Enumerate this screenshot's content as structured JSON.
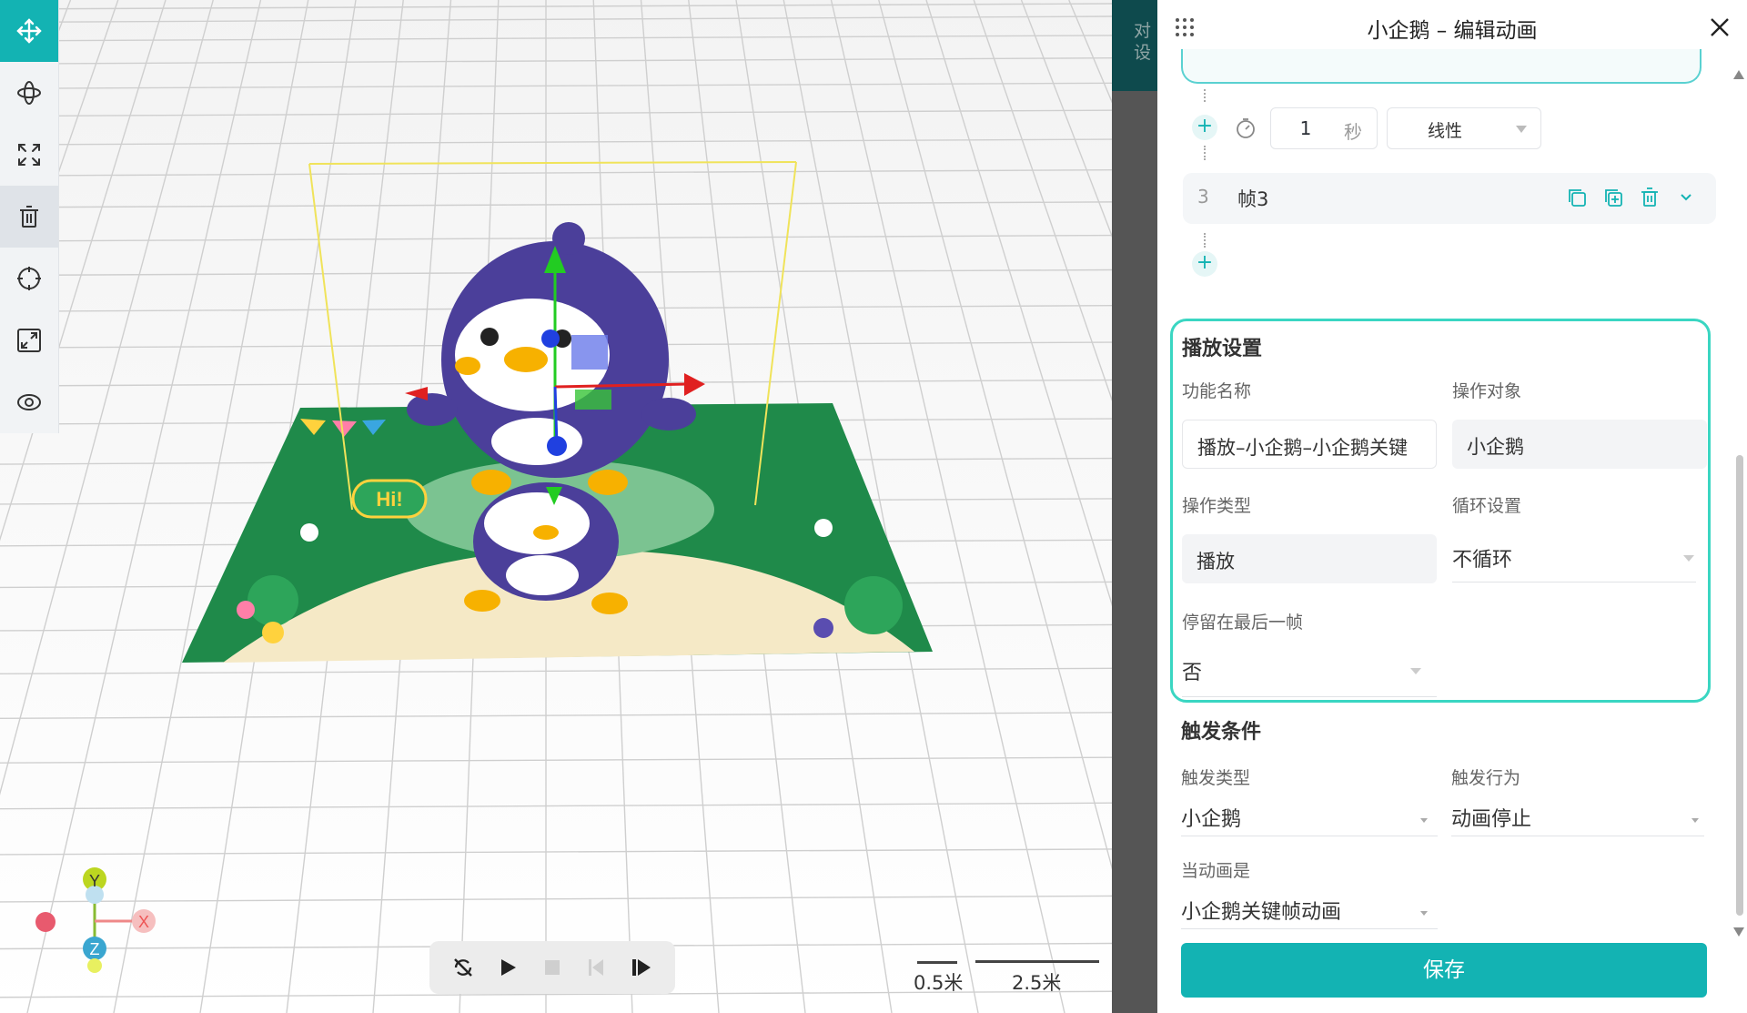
{
  "panel": {
    "title": "小企鹅 – 编辑动画",
    "close_icon": "close-icon",
    "drag_icon": "drag-grid-icon"
  },
  "mid_strip": {
    "text_line1": "对",
    "text_line2": "设"
  },
  "keyframe": {
    "duration_value": "1",
    "duration_unit": "秒",
    "easing": "线性",
    "frame3_index": "3",
    "frame3_label": "帧3"
  },
  "play_settings": {
    "title": "播放设置",
    "function_name_label": "功能名称",
    "function_name_value": "播放–小企鹅–小企鹅关键",
    "target_label": "操作对象",
    "target_value": "小企鹅",
    "op_type_label": "操作类型",
    "op_type_value": "播放",
    "loop_label": "循环设置",
    "loop_value": "不循环",
    "stay_last_label": "停留在最后一帧",
    "stay_last_value": "否"
  },
  "trigger": {
    "title": "触发条件",
    "type_label": "触发类型",
    "type_value": "小企鹅",
    "action_label": "触发行为",
    "action_value": "动画停止",
    "when_label": "当动画是",
    "when_value": "小企鹅关键帧动画"
  },
  "save_label": "保存",
  "viewport": {
    "scale_small": "0.5米",
    "scale_large": "2.5米",
    "axis_y": "Y",
    "axis_x": "X",
    "axis_z": "Z",
    "sign_text": "Hi!"
  },
  "colors": {
    "accent": "#13b3b3",
    "highlight_border": "#3ad6c2",
    "penguin_body": "#4b3f9a",
    "grass": "#1f8a4a"
  },
  "toolbar_icons": [
    "move-icon",
    "rotate-icon",
    "scale-icon",
    "delete-icon",
    "focus-icon",
    "fit-icon",
    "visibility-icon"
  ],
  "playback_icons": [
    "loop-off-icon",
    "play-icon",
    "stop-icon",
    "step-back-icon",
    "step-forward-icon"
  ]
}
